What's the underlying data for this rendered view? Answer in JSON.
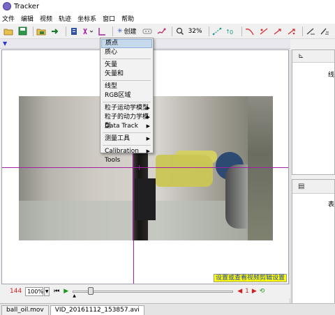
{
  "window": {
    "title": "Tracker"
  },
  "menubar": [
    "文件",
    "编辑",
    "视频",
    "轨迹",
    "坐标系",
    "窗口",
    "帮助"
  ],
  "toolbar": {
    "create_label": "创建",
    "zoom_level": "32%",
    "icons": [
      "open-folder-icon",
      "save-icon",
      "open-video-icon",
      "export-icon",
      "clip-settings-icon",
      "coordinate-axes-icon",
      "tape-measure-icon",
      "create-icon",
      "footprint-icon",
      "trail-icon",
      "zoom-icon",
      "calibration-stick-icon",
      "offset-origin-icon",
      "protractor-icon",
      "point-mass-icon",
      "vector-icon",
      "autotracker-icon",
      "pencil-icon"
    ]
  },
  "create_menu": {
    "items": [
      {
        "label": "质点",
        "selected": true,
        "submenu": false
      },
      {
        "label": "质心",
        "selected": false,
        "submenu": false
      },
      {
        "sep": true
      },
      {
        "label": "矢量",
        "selected": false,
        "submenu": false
      },
      {
        "label": "矢量和",
        "selected": false,
        "submenu": false
      },
      {
        "sep": true
      },
      {
        "label": "线型",
        "selected": false,
        "submenu": false
      },
      {
        "label": "RGB区域",
        "selected": false,
        "submenu": false
      },
      {
        "sep": true
      },
      {
        "label": "粒子运动学模型",
        "selected": false,
        "submenu": true
      },
      {
        "label": "粒子的动力学模型",
        "selected": false,
        "submenu": true
      },
      {
        "label": "Data Track",
        "selected": false,
        "submenu": true
      },
      {
        "sep": true
      },
      {
        "label": "测量工具",
        "selected": false,
        "submenu": true
      },
      {
        "sep": true
      },
      {
        "label": "Calibration Tools",
        "selected": false,
        "submenu": true
      }
    ]
  },
  "video": {
    "clip_settings_link": "设置或查看视频剪辑设置"
  },
  "right_panel": {
    "top_text": "线",
    "bottom_text": "表"
  },
  "player": {
    "frame_number": "144",
    "zoom": "100%",
    "step_value": "1"
  },
  "tabs": [
    "ball_oil.mov",
    "VID_20161112_153857.avi"
  ],
  "colors": {
    "axis": "#a020a0",
    "menu_highlight": "#c6d8ec",
    "frame_number": "#d02020"
  }
}
